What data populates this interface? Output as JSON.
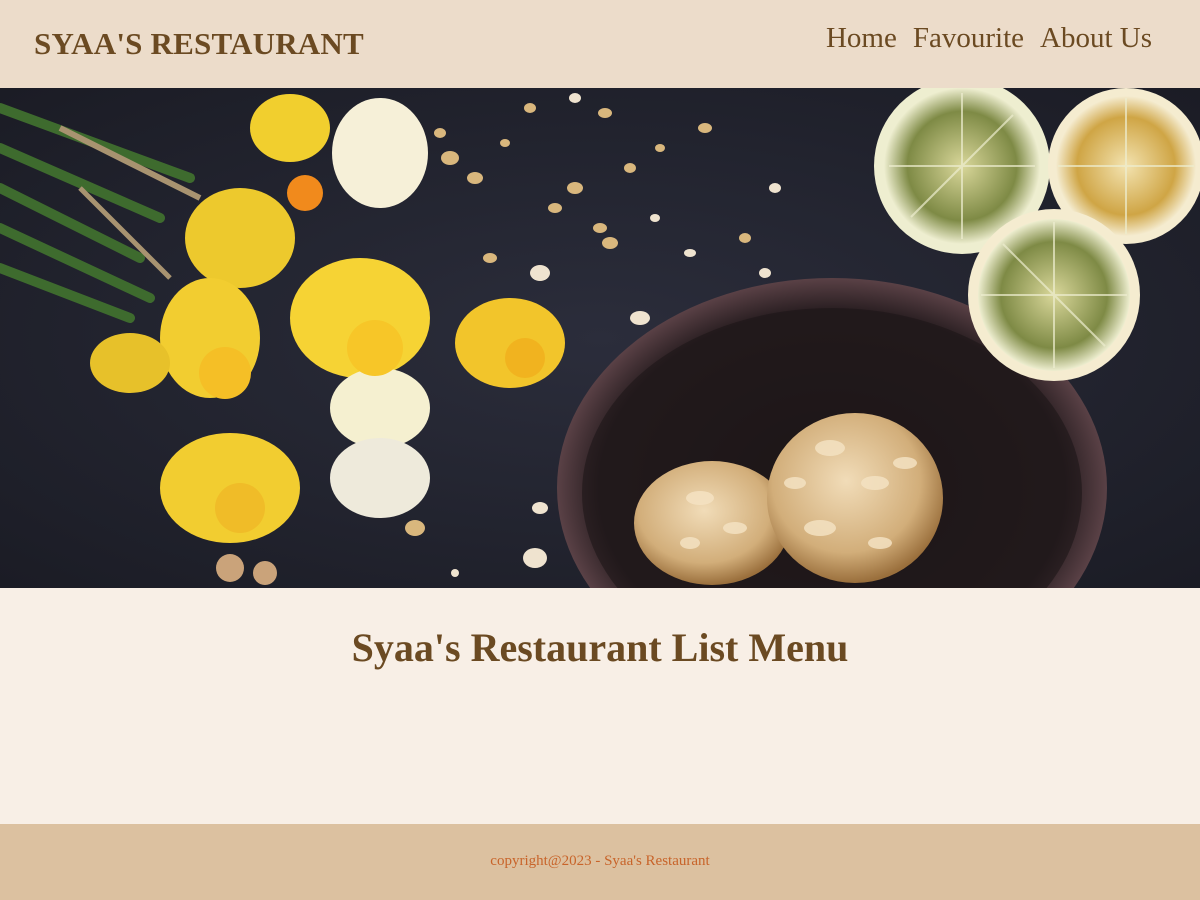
{
  "header": {
    "brand": "SYAA'S RESTAURANT",
    "nav": [
      {
        "label": "Home"
      },
      {
        "label": "Favourite"
      },
      {
        "label": "About Us"
      }
    ]
  },
  "hero": {
    "image_alt_icon": "food-photo-image"
  },
  "main": {
    "title": "Syaa's Restaurant List Menu"
  },
  "footer": {
    "copyright": "copyright@2023 - Syaa's Restaurant"
  },
  "colors": {
    "header_bg": "#ecdcca",
    "page_bg": "#f8efe6",
    "footer_bg": "#dcc1a0",
    "text_brown": "#6b4a22",
    "footer_text": "#c8642a"
  }
}
